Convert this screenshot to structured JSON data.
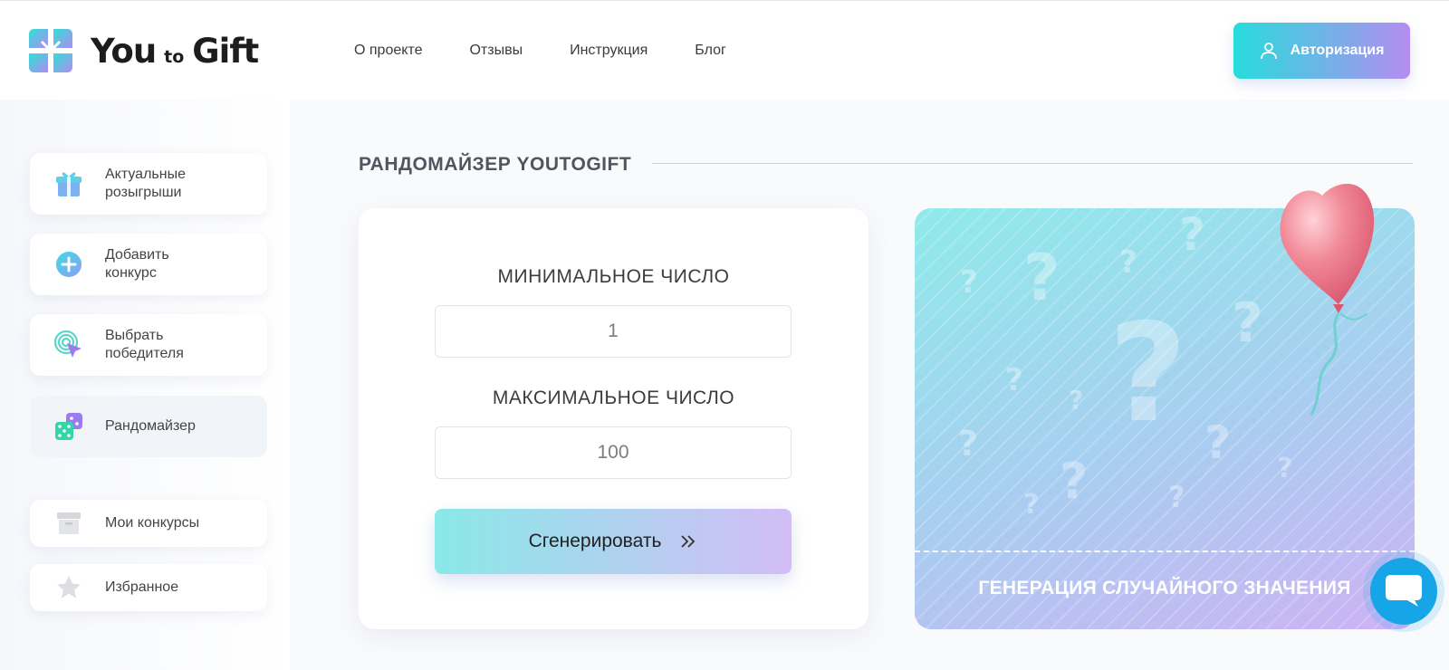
{
  "header": {
    "logo": {
      "word1": "You",
      "word2": "to",
      "word3": "Gift"
    },
    "nav": [
      "О проекте",
      "Отзывы",
      "Инструкция",
      "Блог"
    ],
    "auth_label": "Авторизация"
  },
  "sidebar": {
    "items": [
      {
        "label": "Актуальные розыгрыши",
        "icon": "gift-icon"
      },
      {
        "label": "Добавить конкурс",
        "icon": "plus-circle-icon"
      },
      {
        "label": "Выбрать победителя",
        "icon": "target-cursor-icon"
      },
      {
        "label": "Рандомайзер",
        "icon": "dice-icon",
        "active": true
      },
      {
        "label": "Мои конкурсы",
        "icon": "archive-box-icon"
      },
      {
        "label": "Избранное",
        "icon": "star-icon"
      }
    ]
  },
  "main": {
    "section_title": "РАНДОМАЙЗЕР YOUTOGIFT",
    "min_label": "МИНИМАЛЬНОЕ ЧИСЛО",
    "min_value": "1",
    "max_label": "МАКСИМАЛЬНОЕ ЧИСЛО",
    "max_value": "100",
    "generate_label": "Сгенерировать",
    "promo_caption": "ГЕНЕРАЦИЯ СЛУЧАЙНОГО ЗНАЧЕНИЯ"
  },
  "colors": {
    "accent_start": "#27dcdc",
    "accent_end": "#b58cf0",
    "chat": "#16a6e8"
  }
}
